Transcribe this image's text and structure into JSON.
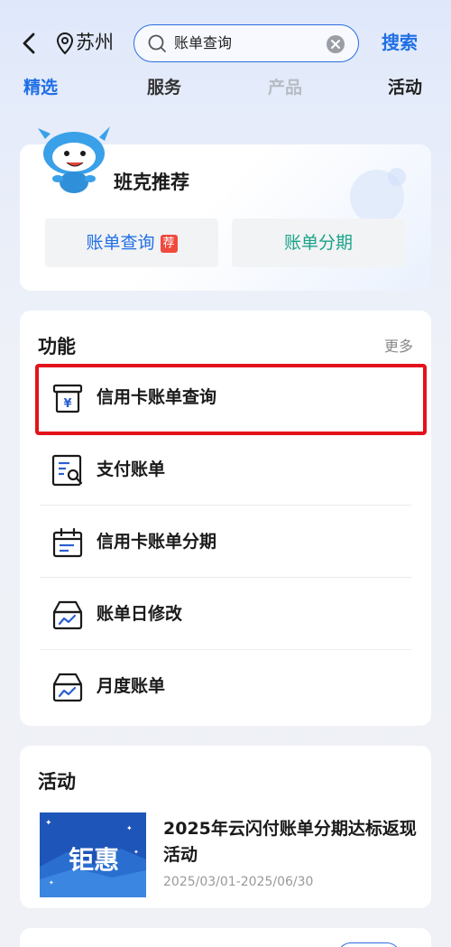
{
  "header": {
    "city": "苏州",
    "search_value": "账单查询",
    "search_button": "搜索"
  },
  "tabs": [
    {
      "label": "精选",
      "active": true
    },
    {
      "label": "服务",
      "active": false
    },
    {
      "label": "产品",
      "active": false
    },
    {
      "label": "活动",
      "active": false
    }
  ],
  "recommend": {
    "title": "班克推荐",
    "buttons": [
      {
        "label": "账单查询",
        "badge": "荐"
      },
      {
        "label": "账单分期",
        "badge": ""
      }
    ]
  },
  "functions": {
    "title": "功能",
    "more": "更多",
    "items": [
      {
        "label": "信用卡账单查询",
        "icon": "bill-yuan-icon",
        "highlighted": true
      },
      {
        "label": "支付账单",
        "icon": "bill-search-icon",
        "highlighted": false
      },
      {
        "label": "信用卡账单分期",
        "icon": "calendar-icon",
        "highlighted": false
      },
      {
        "label": "账单日修改",
        "icon": "box-chart-icon",
        "highlighted": false
      },
      {
        "label": "月度账单",
        "icon": "box-chart-icon",
        "highlighted": false
      }
    ]
  },
  "activity": {
    "title": "活动",
    "image_text": "钜惠",
    "name": "2025年云闪付账单分期达标返现活动",
    "date": "2025/03/01-2025/06/30"
  },
  "colors": {
    "accent": "#1f6fe5",
    "highlight_border": "#e3131b",
    "teal": "#1aa38a",
    "badge": "#f0493e"
  }
}
